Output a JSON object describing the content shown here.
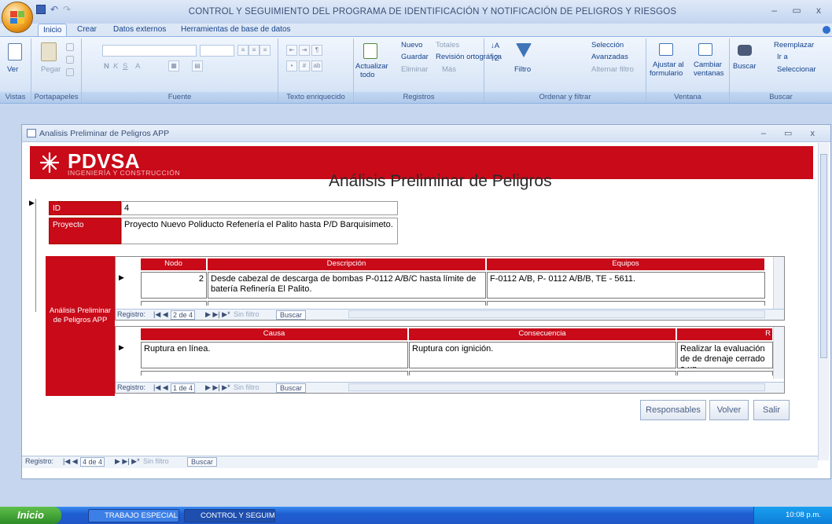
{
  "app": {
    "title": "CONTROL Y SEGUIMIENTO DEL PROGRAMA DE IDENTIFICACIÓN Y NOTIFICACIÓN DE PELIGROS Y RIESGOS",
    "window_controls": "– ▭ x"
  },
  "ribbon_tabs": [
    "Inicio",
    "Crear",
    "Datos externos",
    "Herramientas de base de datos"
  ],
  "ribbon": {
    "vistas": {
      "label": "Vistas",
      "ver": "Ver"
    },
    "portapapeles": {
      "label": "Portapapeles",
      "pegar": "Pegar"
    },
    "fuente": {
      "label": "Fuente",
      "bold": "N",
      "italic": "K",
      "underline": "S",
      "font_a": "A"
    },
    "texto": {
      "label": "Texto enriquecido"
    },
    "registros": {
      "label": "Registros",
      "actualizar": "Actualizar",
      "todo": "todo",
      "nuevo": "Nuevo",
      "guardar": "Guardar",
      "eliminar": "Eliminar",
      "totales": "Totales",
      "revision": "Revisión ortográfica",
      "mas": "Más"
    },
    "ordenar": {
      "label": "Ordenar y filtrar",
      "filtro": "Filtro",
      "seleccion": "Selección",
      "avanzadas": "Avanzadas",
      "alternar": "Alternar filtro"
    },
    "ventana": {
      "label": "Ventana",
      "ajustar": "Ajustar al",
      "formulario": "formulario",
      "cambiar": "Cambiar",
      "ventanas": "ventanas"
    },
    "buscar": {
      "label": "Buscar",
      "buscar": "Buscar",
      "reemplazar": "Reemplazar",
      "ira": "Ir a",
      "seleccionar": "Seleccionar"
    }
  },
  "form_window": {
    "title": "Analisis Preliminar de Peligros APP",
    "controls": "– ▭ x"
  },
  "brand": {
    "name": "PDVSA",
    "subtitle": "INGENIERÍA Y CONSTRUCCIÓN",
    "color": "#c80a19"
  },
  "form": {
    "heading": "Análisis Preliminar de Peligros",
    "id_label": "ID",
    "id_value": "4",
    "proyecto_label": "Proyecto",
    "proyecto_value": "Proyecto Nuevo Poliducto Refenería el Palito hasta P/D Barquisimeto.",
    "subform_label": "Análisis Preliminar de Peligros APP"
  },
  "subform1": {
    "headers": [
      "Nodo",
      "Descripción",
      "Equipos"
    ],
    "row": {
      "nodo": "2",
      "descripcion": "Desde cabezal de descarga de bombas P-0112 A/B/C hasta límite de batería Refinería El Palito.",
      "equipos": "F-0112 A/B, P- 0112 A/B/B, TE - 5611."
    },
    "nav": {
      "registro": "Registro:",
      "pos": "2 de 4",
      "filtro": "Sin filtro",
      "buscar": "Buscar"
    }
  },
  "subform2": {
    "headers": [
      "Causa",
      "Consecuencia",
      "R"
    ],
    "row": {
      "causa": "Ruptura en línea.",
      "consecuencia": "Ruptura con ignición.",
      "recomendacion": "Realizar la evaluación de de drenaje cerrado a un"
    },
    "nav": {
      "registro": "Registro:",
      "pos": "1 de 4",
      "filtro": "Sin filtro",
      "buscar": "Buscar"
    }
  },
  "buttons": {
    "responsables": "Responsables",
    "volver": "Volver",
    "salir": "Salir"
  },
  "main_nav": {
    "registro": "Registro:",
    "pos": "4 de 4",
    "filtro": "Sin filtro",
    "buscar": "Buscar"
  },
  "taskbar": {
    "start": "Inicio",
    "items": [
      "TRABAJO ESPECIAL ...",
      "CONTROL Y SEGUIMI..."
    ],
    "clock": "10:08 p.m."
  }
}
